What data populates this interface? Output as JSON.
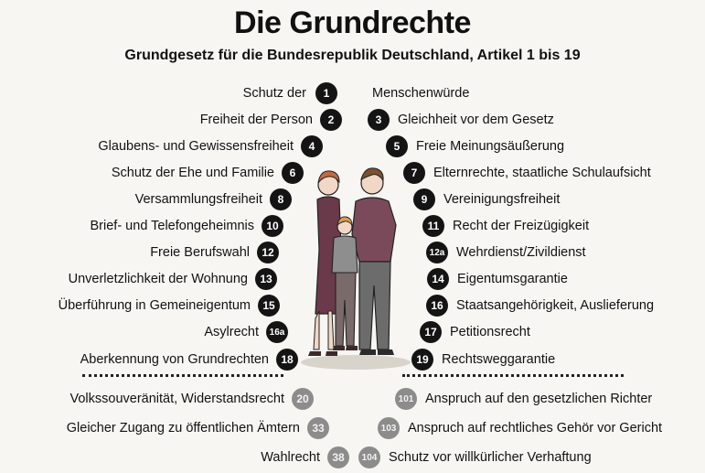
{
  "title": "Die Grundrechte",
  "subtitle": "Grundgesetz für die Bundesrepublik Deutschland, Artikel 1 bis 19",
  "articles": {
    "a1": {
      "num": "1",
      "label_left": "Schutz der",
      "label_right": "Menschenwürde"
    },
    "a2": {
      "num": "2",
      "label": "Freiheit der Person"
    },
    "a3": {
      "num": "3",
      "label": "Gleichheit vor dem Gesetz"
    },
    "a4": {
      "num": "4",
      "label": "Glaubens- und Gewissensfreiheit"
    },
    "a5": {
      "num": "5",
      "label": "Freie Meinungsäußerung"
    },
    "a6": {
      "num": "6",
      "label": "Schutz der Ehe und Familie"
    },
    "a7": {
      "num": "7",
      "label": "Elternrechte, staatliche Schulaufsicht"
    },
    "a8": {
      "num": "8",
      "label": "Versammlungsfreiheit"
    },
    "a9": {
      "num": "9",
      "label": "Vereinigungsfreiheit"
    },
    "a10": {
      "num": "10",
      "label": "Brief- und Telefongeheimnis"
    },
    "a11": {
      "num": "11",
      "label": "Recht der Freizügigkeit"
    },
    "a12": {
      "num": "12",
      "label": "Freie Berufswahl"
    },
    "a12a": {
      "num": "12a",
      "label": "Wehrdienst/Zivildienst"
    },
    "a13": {
      "num": "13",
      "label": "Unverletzlichkeit der Wohnung"
    },
    "a14": {
      "num": "14",
      "label": "Eigentumsgarantie"
    },
    "a15": {
      "num": "15",
      "label": "Überführung in Gemeineigentum"
    },
    "a16": {
      "num": "16",
      "label": "Staatsangehörigkeit, Auslieferung"
    },
    "a16a": {
      "num": "16a",
      "label": "Asylrecht"
    },
    "a17": {
      "num": "17",
      "label": "Petitionsrecht"
    },
    "a18": {
      "num": "18",
      "label": "Aberkennung von Grundrechten"
    },
    "a19": {
      "num": "19",
      "label": "Rechtsweggarantie"
    }
  },
  "other_rights": {
    "a20": {
      "num": "20",
      "label": "Volkssouveränität, Widerstandsrecht"
    },
    "a33": {
      "num": "33",
      "label": "Gleicher Zugang zu öffentlichen Ämtern"
    },
    "a38": {
      "num": "38",
      "label": "Wahlrecht"
    },
    "a101": {
      "num": "101",
      "label": "Anspruch auf den gesetzlichen Richter"
    },
    "a103": {
      "num": "103",
      "label": "Anspruch auf rechtliches Gehör vor Gericht"
    },
    "a104": {
      "num": "104",
      "label": "Schutz vor willkürlicher Verhaftung"
    }
  }
}
